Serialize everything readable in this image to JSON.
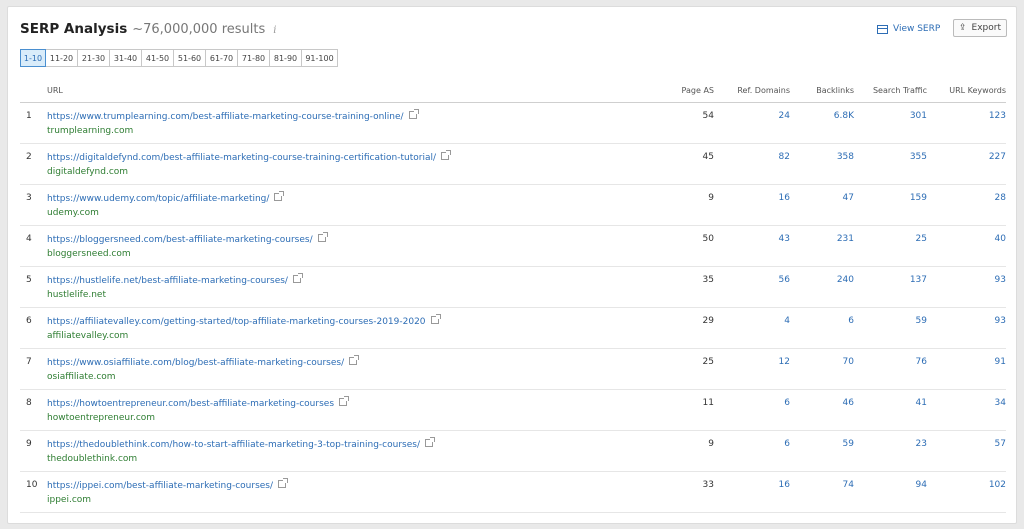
{
  "header": {
    "title": "SERP Analysis",
    "count": "~76,000,000 results",
    "info_icon": "i",
    "view_serp": "View SERP",
    "export": "Export"
  },
  "pagination": [
    "1-10",
    "11-20",
    "21-30",
    "31-40",
    "41-50",
    "51-60",
    "61-70",
    "71-80",
    "81-90",
    "91-100"
  ],
  "pagination_active": "1-10",
  "columns": {
    "url": "URL",
    "page_as": "Page AS",
    "ref_domains": "Ref. Domains",
    "backlinks": "Backlinks",
    "search_traffic": "Search Traffic",
    "url_keywords": "URL Keywords"
  },
  "rows": [
    {
      "n": "1",
      "url": "https://www.trumplearning.com/best-affiliate-marketing-course-training-online/",
      "domain": "trumplearning.com",
      "page_as": "54",
      "ref": "24",
      "bl": "6.8K",
      "st": "301",
      "kw": "123"
    },
    {
      "n": "2",
      "url": "https://digitaldefynd.com/best-affiliate-marketing-course-training-certification-tutorial/",
      "domain": "digitaldefynd.com",
      "page_as": "45",
      "ref": "82",
      "bl": "358",
      "st": "355",
      "kw": "227"
    },
    {
      "n": "3",
      "url": "https://www.udemy.com/topic/affiliate-marketing/",
      "domain": "udemy.com",
      "page_as": "9",
      "ref": "16",
      "bl": "47",
      "st": "159",
      "kw": "28"
    },
    {
      "n": "4",
      "url": "https://bloggersneed.com/best-affiliate-marketing-courses/",
      "domain": "bloggersneed.com",
      "page_as": "50",
      "ref": "43",
      "bl": "231",
      "st": "25",
      "kw": "40"
    },
    {
      "n": "5",
      "url": "https://hustlelife.net/best-affiliate-marketing-courses/",
      "domain": "hustlelife.net",
      "page_as": "35",
      "ref": "56",
      "bl": "240",
      "st": "137",
      "kw": "93"
    },
    {
      "n": "6",
      "url": "https://affiliatevalley.com/getting-started/top-affiliate-marketing-courses-2019-2020",
      "domain": "affiliatevalley.com",
      "page_as": "29",
      "ref": "4",
      "bl": "6",
      "st": "59",
      "kw": "93"
    },
    {
      "n": "7",
      "url": "https://www.osiaffiliate.com/blog/best-affiliate-marketing-courses/",
      "domain": "osiaffiliate.com",
      "page_as": "25",
      "ref": "12",
      "bl": "70",
      "st": "76",
      "kw": "91"
    },
    {
      "n": "8",
      "url": "https://howtoentrepreneur.com/best-affiliate-marketing-courses",
      "domain": "howtoentrepreneur.com",
      "page_as": "11",
      "ref": "6",
      "bl": "46",
      "st": "41",
      "kw": "34"
    },
    {
      "n": "9",
      "url": "https://thedoublethink.com/how-to-start-affiliate-marketing-3-top-training-courses/",
      "domain": "thedoublethink.com",
      "page_as": "9",
      "ref": "6",
      "bl": "59",
      "st": "23",
      "kw": "57"
    },
    {
      "n": "10",
      "url": "https://ippei.com/best-affiliate-marketing-courses/",
      "domain": "ippei.com",
      "page_as": "33",
      "ref": "16",
      "bl": "74",
      "st": "94",
      "kw": "102"
    }
  ],
  "colors": {
    "link": "#2d6db5",
    "domain": "#2e7d32",
    "active_page_bg": "#d9ecfa"
  }
}
